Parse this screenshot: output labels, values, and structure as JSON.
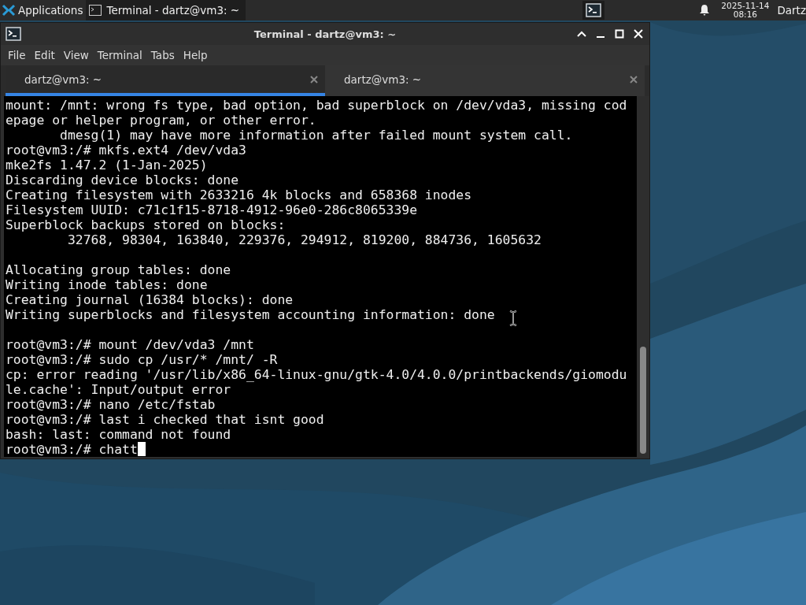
{
  "panel": {
    "applications": "Applications",
    "tasks": [
      {
        "label": "Terminal - dartz@vm3: ~",
        "selected": true
      }
    ],
    "clock": {
      "date": "2025-11-14",
      "time": "08:16"
    },
    "user": "Dartz"
  },
  "window": {
    "title": "Terminal - dartz@vm3: ~",
    "menu": [
      "File",
      "Edit",
      "View",
      "Terminal",
      "Tabs",
      "Help"
    ],
    "tabs": [
      {
        "label": "dartz@vm3: ~",
        "selected": true
      },
      {
        "label": "dartz@vm3: ~",
        "selected": false
      }
    ],
    "terminal": {
      "cursor": true,
      "lines": [
        {
          "text": "mount: /mnt: wrong fs type, bad option, bad superblock on /dev/vda3, missing cod"
        },
        {
          "text": "epage or helper program, or other error."
        },
        {
          "text": "       dmesg(1) may have more information after failed mount system call."
        },
        {
          "text": "root@vm3:/# mkfs.ext4 /dev/vda3"
        },
        {
          "text": "mke2fs 1.47.2 (1-Jan-2025)"
        },
        {
          "text": "Discarding device blocks: done"
        },
        {
          "text": "Creating filesystem with 2633216 4k blocks and 658368 inodes"
        },
        {
          "text": "Filesystem UUID: c71c1f15-8718-4912-96e0-286c8065339e"
        },
        {
          "text": "Superblock backups stored on blocks:"
        },
        {
          "text": "        32768, 98304, 163840, 229376, 294912, 819200, 884736, 1605632"
        },
        {
          "kind": "blank"
        },
        {
          "text": "Allocating group tables: done"
        },
        {
          "text": "Writing inode tables: done"
        },
        {
          "text": "Creating journal (16384 blocks): done"
        },
        {
          "text": "Writing superblocks and filesystem accounting information: done"
        },
        {
          "kind": "blank"
        },
        {
          "text": "root@vm3:/# mount /dev/vda3 /mnt"
        },
        {
          "text": "root@vm3:/# sudo cp /usr/* /mnt/ -R"
        },
        {
          "text": "cp: error reading '/usr/lib/x86_64-linux-gnu/gtk-4.0/4.0.0/printbackends/giomodu"
        },
        {
          "text": "le.cache': Input/output error"
        },
        {
          "text": "root@vm3:/# nano /etc/fstab"
        },
        {
          "text": "root@vm3:/# last i checked that isnt good"
        },
        {
          "text": "bash: last: command not found"
        },
        {
          "text": "root@vm3:/# chatt"
        }
      ]
    }
  }
}
